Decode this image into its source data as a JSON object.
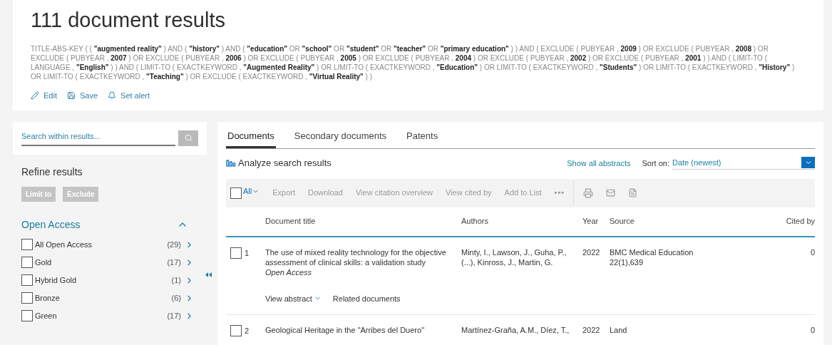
{
  "title": "111 document results",
  "query": "TITLE-ABS-KEY ( ( **\"augmented reality\"** ) AND ( **\"history\"** ) AND ( **\"education\"** OR **\"school\"** OR **\"student\"** OR **\"teacher\"** OR **\"primary education\"** ) ) AND ( EXCLUDE ( PUBYEAR , **2009** ) OR EXCLUDE ( PUBYEAR , **2008** ) OR EXCLUDE ( PUBYEAR , **2007** ) OR EXCLUDE ( PUBYEAR , **2006** ) OR EXCLUDE ( PUBYEAR , **2005** ) OR EXCLUDE ( PUBYEAR , **2004** ) OR EXCLUDE ( PUBYEAR , **2002** ) OR EXCLUDE ( PUBYEAR , **2001** ) ) AND ( LIMIT-TO ( LANGUAGE , **\"English\"** ) ) AND ( LIMIT-TO ( EXACTKEYWORD , **\"Augmented Reality\"** ) OR LIMIT-TO ( EXACTKEYWORD , **\"Education\"** ) OR LIMIT-TO ( EXACTKEYWORD , **\"Students\"** ) OR LIMIT-TO ( EXACTKEYWORD , **\"History\"** ) OR LIMIT-TO ( EXACTKEYWORD , **\"Teaching\"** ) OR EXCLUDE ( EXACTKEYWORD , **\"Virtual Reality\"** ) )",
  "query_actions": [
    {
      "kind": "edit",
      "label": "Edit"
    },
    {
      "kind": "save",
      "label": "Save"
    },
    {
      "kind": "alert",
      "label": "Set alert"
    }
  ],
  "sidebar": {
    "search": {
      "placeholder": "Search within results..."
    },
    "refine_title": "Refine results",
    "refine_buttons": [
      "Limit to",
      "Exclude"
    ],
    "facet": {
      "title": "Open Access",
      "expanded": true,
      "items": [
        {
          "label": "All Open Access",
          "count": "(29)",
          "checked": false
        },
        {
          "label": "Gold",
          "count": "(17)",
          "checked": false
        },
        {
          "label": "Hybrid Gold",
          "count": "(1)",
          "checked": false
        },
        {
          "label": "Bronze",
          "count": "(6)",
          "checked": false
        },
        {
          "label": "Green",
          "count": "(17)",
          "checked": false
        }
      ]
    }
  },
  "tabs": [
    {
      "label": "Documents",
      "selected": true
    },
    {
      "label": "Secondary documents",
      "selected": false
    },
    {
      "label": "Patents",
      "selected": false
    }
  ],
  "analyze": "Analyze search results",
  "show_abstracts": "Show all abstracts",
  "sort_label": "Sort on:",
  "sort_value": "Date (newest)",
  "toolbar": {
    "select_all": {
      "label": "All",
      "checked": false
    },
    "actions": [
      "Export",
      "Download",
      "View citation overview",
      "View cited by",
      "Add to List"
    ],
    "more": "•••"
  },
  "table": {
    "columns": [
      "Document title",
      "Authors",
      "Year",
      "Source",
      "Cited by"
    ],
    "rows": [
      {
        "number": "1",
        "checked": false,
        "title": "The use of mixed reality technology for the objective assessment of clinical skills: a validation study",
        "access": "Open Access",
        "authors": "Minty, I., Lawson, J., Guha, P., (...), Kinross, J., Martin, G.",
        "year": "2022",
        "source": "BMC Medical Education",
        "source_detail": "22(1),639",
        "cited_by": "0",
        "links": [
          "View abstract",
          "Related documents"
        ]
      },
      {
        "number": "2",
        "checked": false,
        "title": "Geological Heritage in the \"Arribes del Duero\"",
        "authors": "Martínez-Graña, A.M., Díez, T.,",
        "year": "2022",
        "source": "Land",
        "cited_by": "0"
      }
    ]
  }
}
